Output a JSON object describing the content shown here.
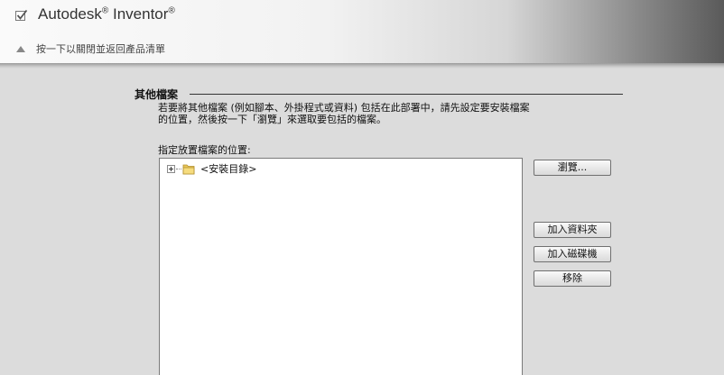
{
  "header": {
    "product_name": "Autodesk",
    "registered_mark": "®",
    "product_suffix": "Inventor",
    "collapse_label": "按一下以關閉並返回產品清單"
  },
  "section": {
    "title": "其他檔案",
    "description_line1": "若要將其他檔案 (例如腳本、外掛程式或資料) 包括在此部署中，請先設定要安裝檔案",
    "description_line2": "的位置，然後按一下「瀏覽」來選取要包括的檔案。",
    "location_label": "指定放置檔案的位置:"
  },
  "tree": {
    "items": [
      {
        "label": "<安裝目錄>"
      }
    ]
  },
  "buttons": {
    "browse": "瀏覽...",
    "add_folder": "加入資料夾",
    "add_drive": "加入磁碟機",
    "remove": "移除"
  }
}
